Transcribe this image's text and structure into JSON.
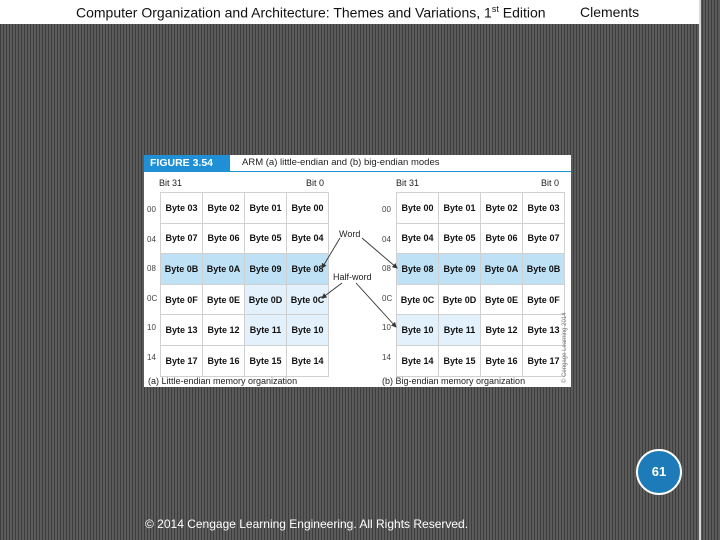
{
  "header": {
    "title": "Computer Organization and Architecture: Themes and Variations, 1",
    "title_sup": "st",
    "title_suffix": " Edition",
    "author": "Clements"
  },
  "figure": {
    "label": "FIGURE 3.54",
    "caption": "ARM (a) little-endian and (b) big-endian modes",
    "left": {
      "bit_high": "Bit 31",
      "bit_low": "Bit 0",
      "addresses": [
        "00",
        "04",
        "08",
        "0C",
        "10",
        "14"
      ],
      "rows": [
        [
          "Byte 03",
          "Byte 02",
          "Byte 01",
          "Byte 00"
        ],
        [
          "Byte 07",
          "Byte 06",
          "Byte 05",
          "Byte 04"
        ],
        [
          "Byte 0B",
          "Byte 0A",
          "Byte 09",
          "Byte 08"
        ],
        [
          "Byte 0F",
          "Byte 0E",
          "Byte 0D",
          "Byte 0C"
        ],
        [
          "Byte 13",
          "Byte 12",
          "Byte 11",
          "Byte 10"
        ],
        [
          "Byte 17",
          "Byte 16",
          "Byte 15",
          "Byte 14"
        ]
      ],
      "subtitle": "(a) Little-endian memory organization"
    },
    "right": {
      "bit_high": "Bit 31",
      "bit_low": "Bit 0",
      "addresses": [
        "00",
        "04",
        "08",
        "0C",
        "10",
        "14"
      ],
      "rows": [
        [
          "Byte 00",
          "Byte 01",
          "Byte 02",
          "Byte 03"
        ],
        [
          "Byte 04",
          "Byte 05",
          "Byte 06",
          "Byte 07"
        ],
        [
          "Byte 08",
          "Byte 09",
          "Byte 0A",
          "Byte 0B"
        ],
        [
          "Byte 0C",
          "Byte 0D",
          "Byte 0E",
          "Byte 0F"
        ],
        [
          "Byte 10",
          "Byte 11",
          "Byte 12",
          "Byte 13"
        ],
        [
          "Byte 14",
          "Byte 15",
          "Byte 16",
          "Byte 17"
        ]
      ],
      "subtitle": "(b) Big-endian memory organization"
    },
    "word_label": "Word",
    "halfword_label": "Half-word",
    "copyright_note": "© Cengage Learning 2014"
  },
  "page_number": "61",
  "footer": "© 2014 Cengage Learning Engineering. All Rights Reserved.",
  "colors": {
    "figure_label_bg": "#1f8fd6",
    "word_highlight": "#bfe1f6",
    "halfword_highlight": "#e2f1fb",
    "page_badge": "#1e7bb9"
  }
}
